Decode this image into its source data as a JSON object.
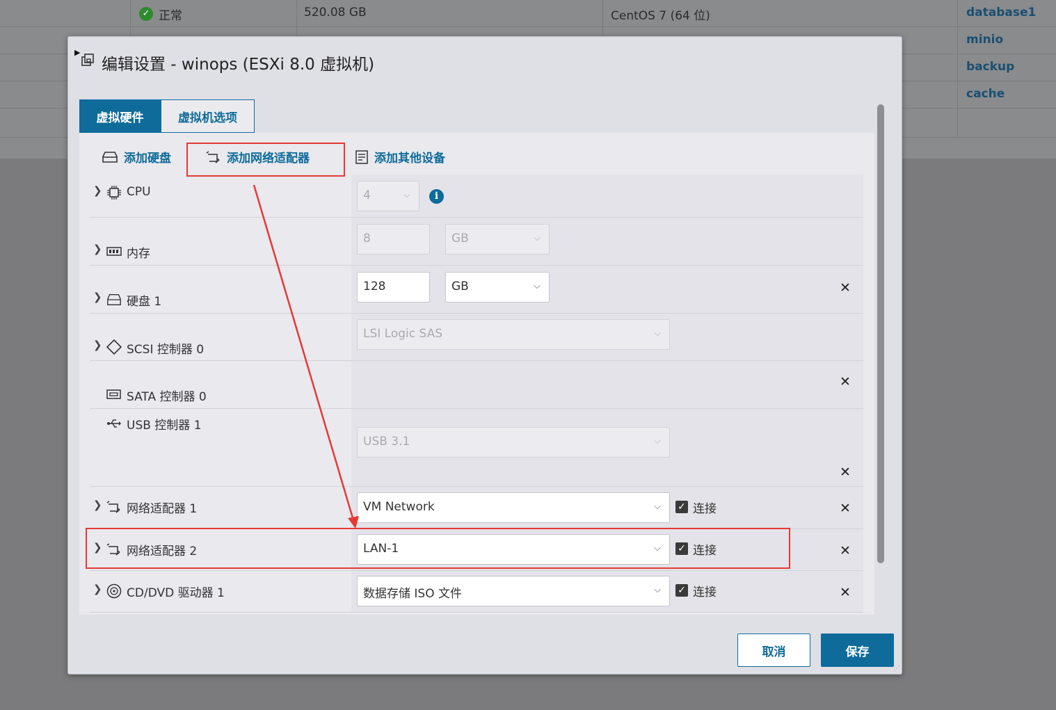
{
  "background": {
    "rows": [
      {
        "status": "正常",
        "size": "520.08 GB",
        "os": "CentOS 7 (64 位)",
        "name": "database1"
      },
      {
        "name": "minio"
      },
      {
        "name": "backup"
      },
      {
        "name": "cache"
      }
    ]
  },
  "dialog": {
    "title": "编辑设置 - winops (ESXi 8.0 虚拟机)",
    "tabs": [
      {
        "label": "虚拟硬件",
        "active": true
      },
      {
        "label": "虚拟机选项",
        "active": false
      }
    ],
    "toolbar": {
      "add_disk": "添加硬盘",
      "add_network_adapter": "添加网络适配器",
      "add_other_device": "添加其他设备"
    },
    "rows": {
      "cpu": {
        "label": "CPU",
        "value": "4"
      },
      "memory": {
        "label": "内存",
        "value": "8",
        "unit": "GB"
      },
      "disk": {
        "label": "硬盘 1",
        "value": "128",
        "unit": "GB"
      },
      "scsi": {
        "label": "SCSI 控制器 0",
        "value": "LSI Logic SAS"
      },
      "sata": {
        "label": "SATA 控制器 0"
      },
      "usb": {
        "label": "USB 控制器 1",
        "value": "USB 3.1"
      },
      "nic1": {
        "label": "网络适配器 1",
        "value": "VM Network",
        "connect_label": "连接",
        "connected": true
      },
      "nic2": {
        "label": "网络适配器 2",
        "value": "LAN-1",
        "connect_label": "连接",
        "connected": true
      },
      "cdrom": {
        "label": "CD/DVD 驱动器 1",
        "value": "数据存储 ISO 文件",
        "connect_label": "连接",
        "connected": true
      }
    },
    "buttons": {
      "cancel": "取消",
      "save": "保存"
    }
  },
  "colors": {
    "accent": "#0f6b9a",
    "highlight": "#e53935"
  }
}
